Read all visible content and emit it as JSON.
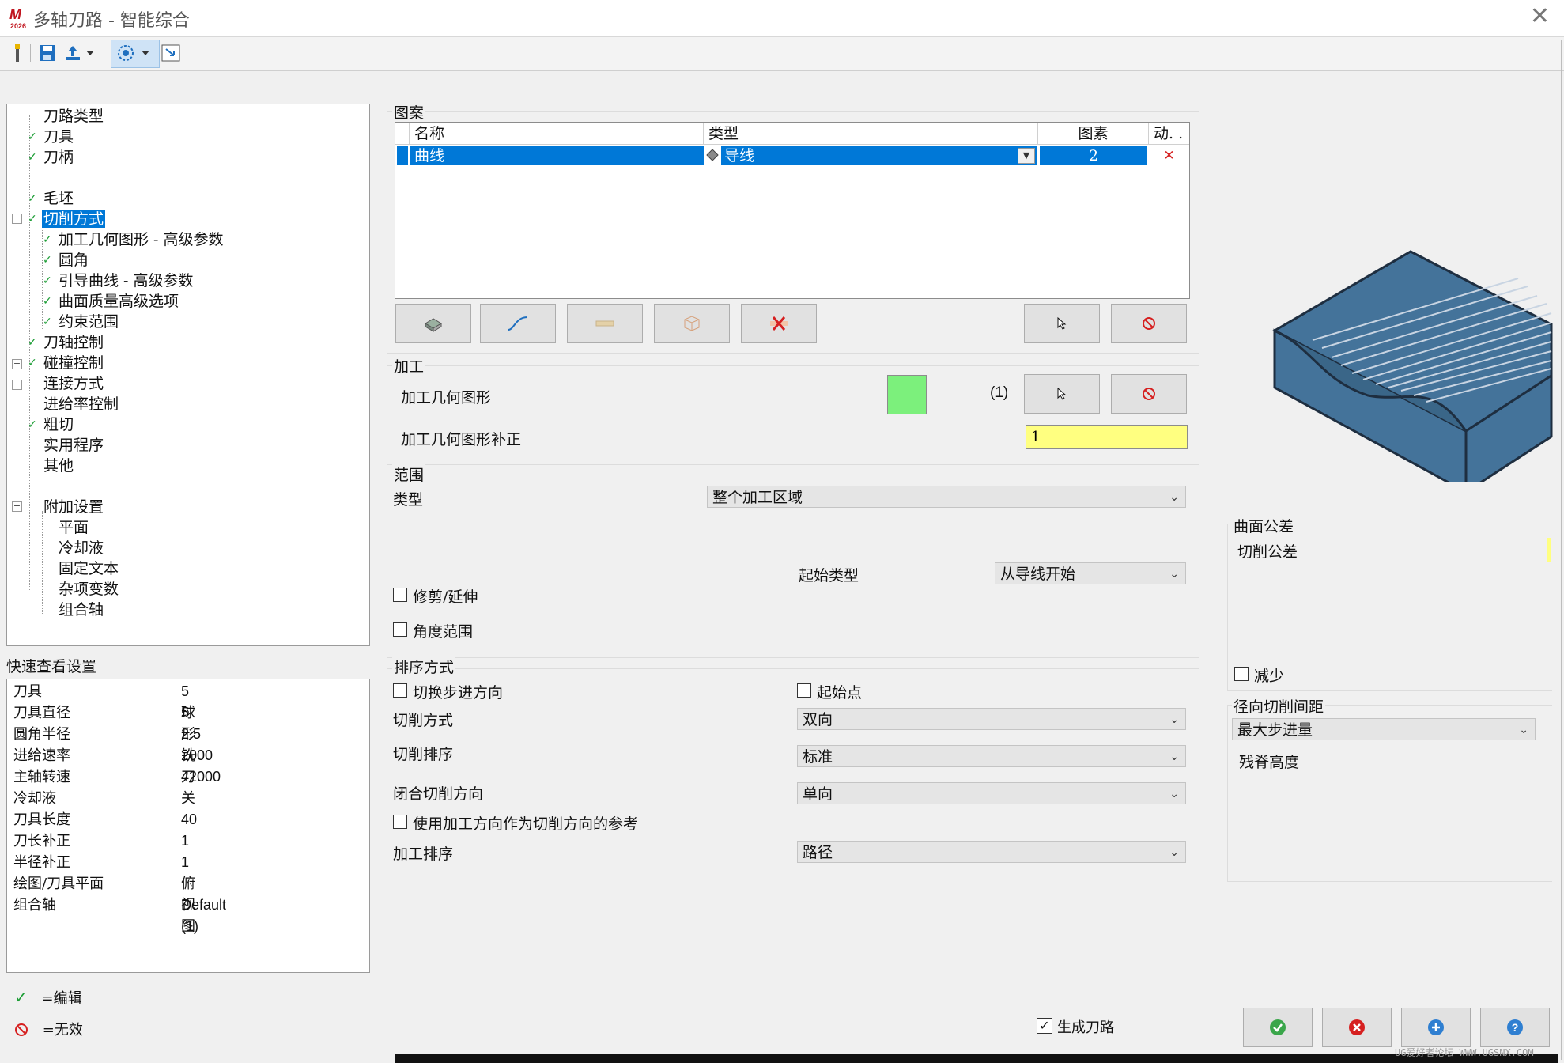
{
  "window": {
    "title": "多轴刀路 - 智能综合",
    "logo_text": "2026",
    "close_glyph": "✕"
  },
  "toolbar": {
    "icons": [
      "toolpath-icon",
      "save-icon",
      "export-icon",
      "dropdown-icon",
      "view-icon",
      "dropdown-icon",
      "window-icon"
    ]
  },
  "tree": {
    "items": [
      {
        "label": "刀路类型",
        "checked": false
      },
      {
        "label": "刀具",
        "checked": true
      },
      {
        "label": "刀柄",
        "checked": true
      },
      {
        "label": "",
        "checked": false
      },
      {
        "label": "毛坯",
        "checked": true
      },
      {
        "label": "切削方式",
        "checked": true
      },
      {
        "label": "加工几何图形 - 高级参数",
        "checked": true
      },
      {
        "label": "圆角",
        "checked": true
      },
      {
        "label": "引导曲线 - 高级参数",
        "checked": true
      },
      {
        "label": "曲面质量高级选项",
        "checked": true
      },
      {
        "label": "约束范围",
        "checked": true
      },
      {
        "label": "刀轴控制",
        "checked": true
      },
      {
        "label": "碰撞控制",
        "checked": true
      },
      {
        "label": "连接方式",
        "checked": false
      },
      {
        "label": "进给率控制",
        "checked": false
      },
      {
        "label": "粗切",
        "checked": true
      },
      {
        "label": "实用程序",
        "checked": false
      },
      {
        "label": "其他",
        "checked": false
      },
      {
        "label": "",
        "checked": false
      },
      {
        "label": "附加设置",
        "checked": false
      },
      {
        "label": "平面",
        "checked": false
      },
      {
        "label": "冷却液",
        "checked": false
      },
      {
        "label": "固定文本",
        "checked": false
      },
      {
        "label": "杂项变数",
        "checked": false
      },
      {
        "label": "组合轴",
        "checked": false
      }
    ]
  },
  "quick_view": {
    "title": "快速查看设置",
    "rows": [
      {
        "key": "刀具",
        "value": "5球形铣刀"
      },
      {
        "key": "刀具直径",
        "value": "5"
      },
      {
        "key": "圆角半径",
        "value": "2.5"
      },
      {
        "key": "进给速率",
        "value": "2000"
      },
      {
        "key": "主轴转速",
        "value": "42000"
      },
      {
        "key": "冷却液",
        "value": "关"
      },
      {
        "key": "刀具长度",
        "value": "40"
      },
      {
        "key": "刀长补正",
        "value": "1"
      },
      {
        "key": "半径补正",
        "value": "1"
      },
      {
        "key": "绘图/刀具平面",
        "value": "俯视图"
      },
      {
        "key": "组合轴",
        "value": "Default (1)"
      }
    ]
  },
  "legend": {
    "edit": "=编辑",
    "invalid": "=无效"
  },
  "pattern": {
    "title": "图案",
    "columns": [
      "名称",
      "类型",
      "图素",
      "动. ."
    ],
    "row": {
      "name": "曲线",
      "type": "导线",
      "count": "2",
      "action": "✕"
    }
  },
  "machining": {
    "title": "加工",
    "geometry_label": "加工几何图形",
    "geometry_count": "(1)",
    "geometry_color": "#7cf07c",
    "offset_label": "加工几何图形补正",
    "offset_value": "1"
  },
  "range": {
    "title": "范围",
    "type_label": "类型",
    "type_value": "整个加工区域",
    "start_type_label": "起始类型",
    "start_type_value": "从导线开始",
    "trim_label": "修剪/延伸",
    "angle_label": "角度范围"
  },
  "ordering": {
    "title": "排序方式",
    "switch_step_label": "切换步进方向",
    "start_point_label": "起始点",
    "cut_method_label": "切削方式",
    "cut_method_value": "双向",
    "cut_order_label": "切削排序",
    "cut_order_value": "标准",
    "closed_dir_label": "闭合切削方向",
    "closed_dir_value": "单向",
    "use_machine_dir_label": "使用加工方向作为切削方向的参考",
    "machine_order_label": "加工排序",
    "machine_order_value": "路径"
  },
  "surface_tolerance": {
    "title": "曲面公差",
    "cut_tolerance_label": "切削公差",
    "reduce_label": "减少"
  },
  "radial": {
    "title": "径向切削间距",
    "mode_value": "最大步进量",
    "scallop_label": "残脊高度"
  },
  "footer": {
    "generate_label": "生成刀路",
    "generate_checked": true,
    "watermark": "UG爱好者论坛 WWW.UGSNX.COM"
  }
}
